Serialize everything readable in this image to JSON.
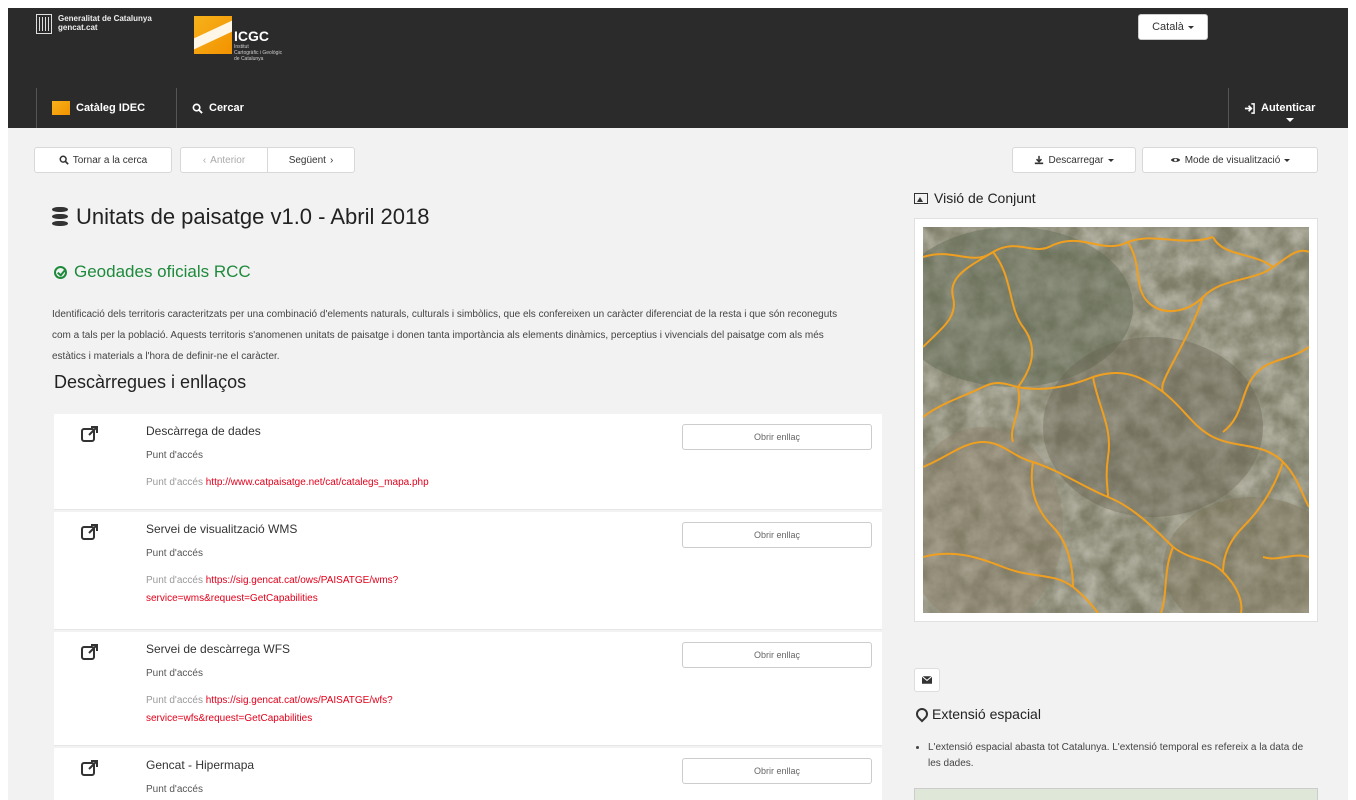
{
  "header": {
    "gencat_line1": "Generalitat de Catalunya",
    "gencat_line2": "gencat.cat",
    "icgc_name": "ICGC",
    "icgc_sub1": "Institut",
    "icgc_sub2": "Cartogràfic i Geològic",
    "icgc_sub3": "de Catalunya",
    "language": "Català"
  },
  "nav": {
    "catalog": "Catàleg IDEC",
    "search": "Cercar",
    "login": "Autenticar"
  },
  "toolbar": {
    "back": "Tornar a la cerca",
    "previous": "Anterior",
    "next": "Següent",
    "download": "Descarregar",
    "view_mode": "Mode de visualització"
  },
  "record": {
    "title": "Unitats de paisatge v1.0 - Abril 2018",
    "official_badge": "Geodades oficials RCC",
    "description": "Identificació dels territoris caracteritzats per una combinació d'elements naturals, culturals i simbòlics, que els confereixen un caràcter diferenciat de la resta i que són reconeguts com a tals per la població. Aquests territoris s'anomenen unitats de paisatge i donen tanta importància als elements dinàmics, perceptius i vivencials del paisatge com als més estàtics i materials a l'hora de definir-ne el caràcter.",
    "downloads_title": "Descàrregues i enllaços"
  },
  "links": [
    {
      "title": "Descàrrega de dades",
      "subtitle": "Punt d'accés",
      "url_label": "Punt d'accés",
      "url": "http://www.catpaisatge.net/cat/catalegs_mapa.php",
      "button": "Obrir enllaç"
    },
    {
      "title": "Servei de visualització WMS",
      "subtitle": "Punt d'accés",
      "url_label": "Punt d'accés",
      "url": "https://sig.gencat.cat/ows/PAISATGE/wms?service=wms&request=GetCapabilities",
      "button": "Obrir enllaç"
    },
    {
      "title": "Servei de descàrrega WFS",
      "subtitle": "Punt d'accés",
      "url_label": "Punt d'accés",
      "url": "https://sig.gencat.cat/ows/PAISATGE/wfs?service=wfs&request=GetCapabilities",
      "button": "Obrir enllaç"
    },
    {
      "title": "Gencat - Hipermapa",
      "subtitle": "Punt d'accés",
      "url_label": "",
      "url": "",
      "button": "Obrir enllaç"
    }
  ],
  "sidebar": {
    "overview_title": "Visió de Conjunt",
    "extent_title": "Extensió espacial",
    "extent_text": "L'extensió espacial abasta tot Catalunya. L'extensió temporal es refereix a la data de les dades."
  },
  "colors": {
    "header_bg": "#2b2b2b",
    "official_green": "#1e8a3c",
    "link_red": "#e3001b",
    "boundary_orange": "#f0a020"
  }
}
